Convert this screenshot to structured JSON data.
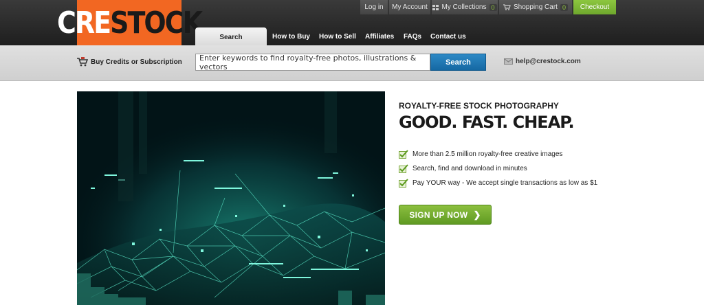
{
  "logo": {
    "part_a": "CRE",
    "part_b": "STOCK",
    "bg_color": "#f26722"
  },
  "util_nav": {
    "login": "Log in",
    "my_account": "My Account",
    "my_collections": "My Collections",
    "my_collections_count": "0",
    "shopping_cart": "Shopping Cart",
    "shopping_cart_count": "0",
    "checkout": "Checkout"
  },
  "main_nav": {
    "search_tab": "Search",
    "items": [
      "How to Buy",
      "How to Sell",
      "Affiliates",
      "FAQs",
      "Contact us"
    ]
  },
  "search": {
    "credits_link": "Buy Credits or Subscription",
    "placeholder": "Enter keywords to find royalty-free photos, illustrations & vectors",
    "button": "Search",
    "email": "help@crestock.com"
  },
  "hero": {
    "tagline": "ROYALTY-FREE STOCK PHOTOGRAPHY",
    "headline": "GOOD. FAST. CHEAP.",
    "features": [
      "More than 2.5 million royalty-free creative images",
      "Search, find and download in minutes",
      "Pay YOUR way - We accept single transactions as low as $1"
    ],
    "cta": "SIGN UP NOW",
    "cta_arrow_icon": "chevron-right-icon"
  },
  "colors": {
    "accent_green": "#8cc63f",
    "search_blue": "#1f78b8"
  }
}
